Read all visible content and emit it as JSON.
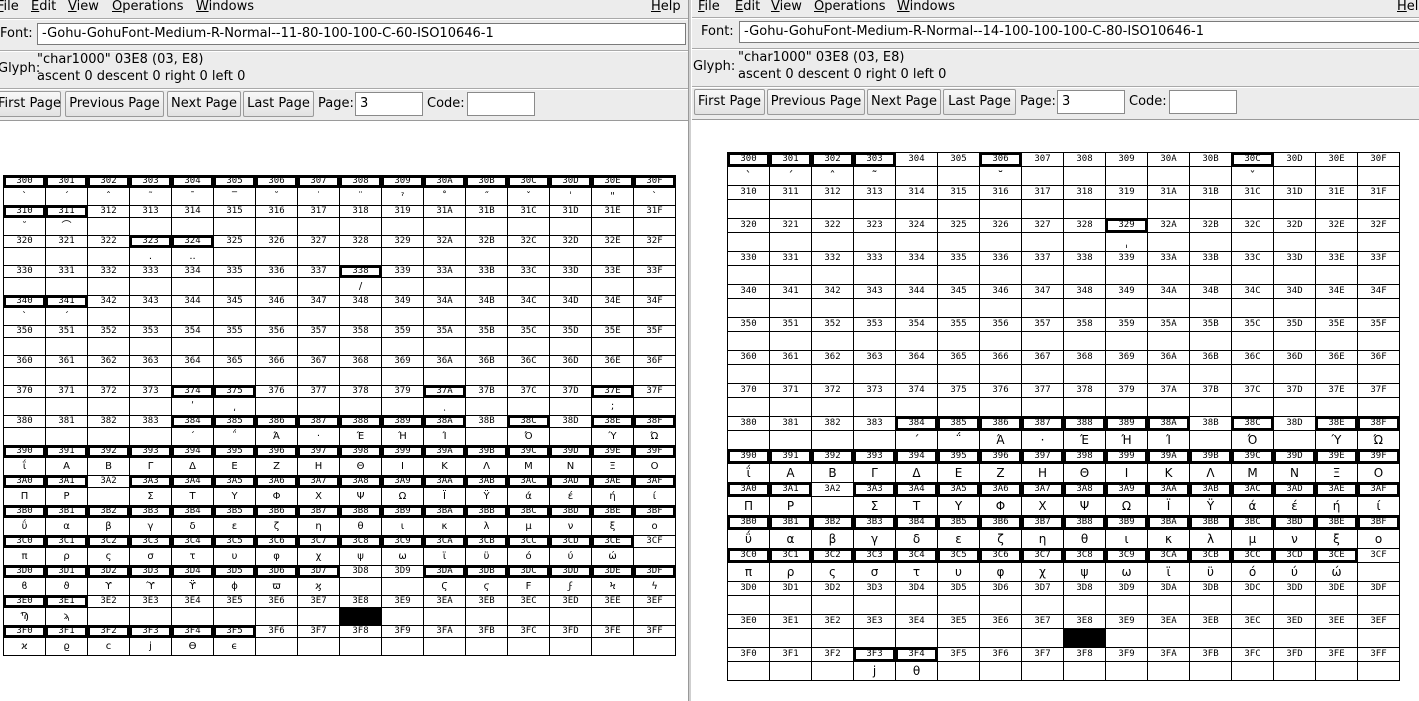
{
  "menu": [
    "File",
    "Edit",
    "View",
    "Operations",
    "Windows",
    "Help"
  ],
  "labels": {
    "font": "Font:",
    "glyph": "Glyph:",
    "first": "First Page",
    "previous": "Previous Page",
    "next": "Next Page",
    "last": "Last Page",
    "page": "Page:",
    "code": "Code:"
  },
  "left": {
    "font_name": "-Gohu-GohuFont-Medium-R-Normal--11-80-100-100-C-60-ISO10646-1",
    "glyph_line1": "\"char1000\" 03E8 (03, E8)",
    "glyph_line2": "ascent 0 descent 0 right 0 left 0",
    "page": "3",
    "code": "",
    "active_cells": [
      "300",
      "301",
      "302",
      "303",
      "304",
      "305",
      "306",
      "307",
      "308",
      "309",
      "30A",
      "30B",
      "30C",
      "30D",
      "30E",
      "30F",
      "310",
      "311",
      "323",
      "324",
      "338",
      "340",
      "341",
      "374",
      "375",
      "37A",
      "37E",
      "384",
      "385",
      "386",
      "387",
      "388",
      "389",
      "38A",
      "38C",
      "38E",
      "38F",
      "390",
      "391",
      "392",
      "393",
      "394",
      "395",
      "396",
      "397",
      "398",
      "399",
      "39A",
      "39B",
      "39C",
      "39D",
      "39E",
      "39F",
      "3A0",
      "3A1",
      "3A3",
      "3A4",
      "3A5",
      "3A6",
      "3A7",
      "3A8",
      "3A9",
      "3AA",
      "3AB",
      "3AC",
      "3AD",
      "3AE",
      "3AF",
      "3B0",
      "3B1",
      "3B2",
      "3B3",
      "3B4",
      "3B5",
      "3B6",
      "3B7",
      "3B8",
      "3B9",
      "3BA",
      "3BB",
      "3BC",
      "3BD",
      "3BE",
      "3BF",
      "3C0",
      "3C1",
      "3C2",
      "3C3",
      "3C4",
      "3C5",
      "3C6",
      "3C7",
      "3C8",
      "3C9",
      "3CA",
      "3CB",
      "3CC",
      "3CD",
      "3CE",
      "3D0",
      "3D1",
      "3D2",
      "3D3",
      "3D4",
      "3D5",
      "3D6",
      "3D7",
      "3DA",
      "3DB",
      "3DC",
      "3DD",
      "3DE",
      "3DF",
      "3E0",
      "3E1",
      "3F0",
      "3F1",
      "3F2",
      "3F3",
      "3F4",
      "3F5"
    ],
    "glyphs": {
      "300": "`",
      "301": "´",
      "302": "ˆ",
      "303": "˜",
      "304": "¯",
      "305": "‾",
      "306": "˘",
      "307": "˙",
      "308": "¨",
      "309": "ˀ",
      "30A": "˚",
      "30B": "˝",
      "30C": "ˇ",
      "30D": "ˈ",
      "30E": "\"",
      "30F": "ˋ",
      "310": "˘",
      "311": "⌒",
      "323": ".",
      "324": "..",
      "338": "/",
      "340": "`",
      "341": "´",
      "374": "ʹ",
      "375": "͵",
      "37A": "ͺ",
      "37E": ";",
      "384": "΄",
      "385": "΅",
      "386": "Ά",
      "387": "·",
      "388": "Έ",
      "389": "Ή",
      "38A": "Ί",
      "38C": "Ό",
      "38E": "Ύ",
      "38F": "Ώ",
      "390": "ΐ",
      "391": "Α",
      "392": "Β",
      "393": "Γ",
      "394": "Δ",
      "395": "Ε",
      "396": "Ζ",
      "397": "Η",
      "398": "Θ",
      "399": "Ι",
      "39A": "Κ",
      "39B": "Λ",
      "39C": "Μ",
      "39D": "Ν",
      "39E": "Ξ",
      "39F": "Ο",
      "3A0": "Π",
      "3A1": "Ρ",
      "3A3": "Σ",
      "3A4": "Τ",
      "3A5": "Υ",
      "3A6": "Φ",
      "3A7": "Χ",
      "3A8": "Ψ",
      "3A9": "Ω",
      "3AA": "Ϊ",
      "3AB": "Ϋ",
      "3AC": "ά",
      "3AD": "έ",
      "3AE": "ή",
      "3AF": "ί",
      "3B0": "ΰ",
      "3B1": "α",
      "3B2": "β",
      "3B3": "γ",
      "3B4": "δ",
      "3B5": "ε",
      "3B6": "ζ",
      "3B7": "η",
      "3B8": "θ",
      "3B9": "ι",
      "3BA": "κ",
      "3BB": "λ",
      "3BC": "μ",
      "3BD": "ν",
      "3BE": "ξ",
      "3BF": "ο",
      "3C0": "π",
      "3C1": "ρ",
      "3C2": "ς",
      "3C3": "σ",
      "3C4": "τ",
      "3C5": "υ",
      "3C6": "φ",
      "3C7": "χ",
      "3C8": "ψ",
      "3C9": "ω",
      "3CA": "ϊ",
      "3CB": "ϋ",
      "3CC": "ό",
      "3CD": "ύ",
      "3CE": "ώ",
      "3D0": "ϐ",
      "3D1": "ϑ",
      "3D2": "ϒ",
      "3D3": "ϓ",
      "3D4": "ϔ",
      "3D5": "ϕ",
      "3D6": "ϖ",
      "3D7": "ϗ",
      "3DA": "Ϛ",
      "3DB": "ϛ",
      "3DC": "Ϝ",
      "3DD": "ϝ",
      "3DE": "Ϟ",
      "3DF": "ϟ",
      "3E0": "Ϡ",
      "3E1": "ϡ",
      "3F0": "ϰ",
      "3F1": "ϱ",
      "3F2": "ϲ",
      "3F3": "ϳ",
      "3F4": "ϴ",
      "3F5": "ϵ"
    },
    "selected": "3E8"
  },
  "right": {
    "font_name": "-Gohu-GohuFont-Medium-R-Normal--14-100-100-100-C-80-ISO10646-1",
    "glyph_line1": "\"char1000\" 03E8 (03, E8)",
    "glyph_line2": "ascent 0 descent 0 right 0 left 0",
    "page": "3",
    "code": "",
    "active_cells": [
      "300",
      "301",
      "302",
      "303",
      "306",
      "30C",
      "329",
      "384",
      "385",
      "386",
      "387",
      "388",
      "389",
      "38A",
      "38C",
      "38E",
      "38F",
      "390",
      "391",
      "392",
      "393",
      "394",
      "395",
      "396",
      "397",
      "398",
      "399",
      "39A",
      "39B",
      "39C",
      "39D",
      "39E",
      "39F",
      "3A0",
      "3A1",
      "3A3",
      "3A4",
      "3A5",
      "3A6",
      "3A7",
      "3A8",
      "3A9",
      "3AA",
      "3AB",
      "3AC",
      "3AD",
      "3AE",
      "3AF",
      "3B0",
      "3B1",
      "3B2",
      "3B3",
      "3B4",
      "3B5",
      "3B6",
      "3B7",
      "3B8",
      "3B9",
      "3BA",
      "3BB",
      "3BC",
      "3BD",
      "3BE",
      "3BF",
      "3C0",
      "3C1",
      "3C2",
      "3C3",
      "3C4",
      "3C5",
      "3C6",
      "3C7",
      "3C8",
      "3C9",
      "3CA",
      "3CB",
      "3CC",
      "3CD",
      "3CE",
      "3F3",
      "3F4"
    ],
    "glyphs": {
      "300": "`",
      "301": "´",
      "302": "ˆ",
      "303": "˜",
      "306": "˘",
      "30C": "ˇ",
      "329": "ˌ",
      "384": "΄",
      "385": "΅",
      "386": "Ά",
      "387": "·",
      "388": "Έ",
      "389": "Ή",
      "38A": "Ί",
      "38C": "Ό",
      "38E": "Ύ",
      "38F": "Ώ",
      "390": "ΐ",
      "391": "Α",
      "392": "Β",
      "393": "Γ",
      "394": "Δ",
      "395": "Ε",
      "396": "Ζ",
      "397": "Η",
      "398": "Θ",
      "399": "Ι",
      "39A": "Κ",
      "39B": "Λ",
      "39C": "Μ",
      "39D": "Ν",
      "39E": "Ξ",
      "39F": "Ο",
      "3A0": "Π",
      "3A1": "Ρ",
      "3A3": "Σ",
      "3A4": "Τ",
      "3A5": "Υ",
      "3A6": "Φ",
      "3A7": "Χ",
      "3A8": "Ψ",
      "3A9": "Ω",
      "3AA": "Ϊ",
      "3AB": "Ϋ",
      "3AC": "ά",
      "3AD": "έ",
      "3AE": "ή",
      "3AF": "ί",
      "3B0": "ΰ",
      "3B1": "α",
      "3B2": "β",
      "3B3": "γ",
      "3B4": "δ",
      "3B5": "ε",
      "3B6": "ζ",
      "3B7": "η",
      "3B8": "θ",
      "3B9": "ι",
      "3BA": "κ",
      "3BB": "λ",
      "3BC": "μ",
      "3BD": "ν",
      "3BE": "ξ",
      "3BF": "ο",
      "3C0": "π",
      "3C1": "ρ",
      "3C2": "ς",
      "3C3": "σ",
      "3C4": "τ",
      "3C5": "υ",
      "3C6": "φ",
      "3C7": "χ",
      "3C8": "ψ",
      "3C9": "ω",
      "3CA": "ϊ",
      "3CB": "ϋ",
      "3CC": "ό",
      "3CD": "ύ",
      "3CE": "ώ",
      "3F3": "j",
      "3F4": "θ"
    },
    "selected": "3E8"
  }
}
